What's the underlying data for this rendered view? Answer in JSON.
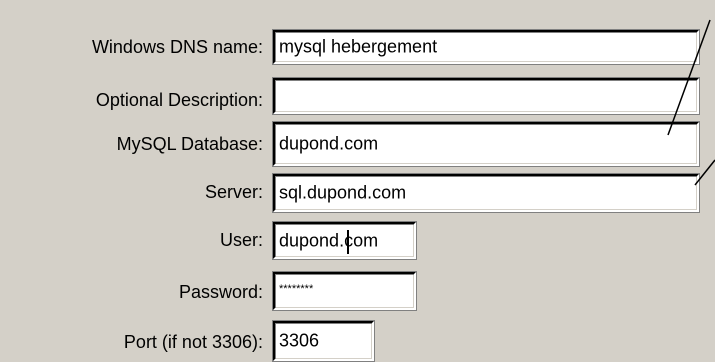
{
  "form": {
    "dns_name": {
      "label": "Windows DNS name:",
      "value": "mysql hebergement"
    },
    "description": {
      "label": "Optional Description:",
      "value": ""
    },
    "database": {
      "label": "MySQL Database:",
      "value": "dupond.com"
    },
    "server": {
      "label": "Server:",
      "value": "sql.dupond.com"
    },
    "user": {
      "label": "User:",
      "value": "dupond.com"
    },
    "password": {
      "label": "Password:",
      "value": "********"
    },
    "port": {
      "label": "Port (if not 3306):",
      "value": "3306"
    }
  }
}
